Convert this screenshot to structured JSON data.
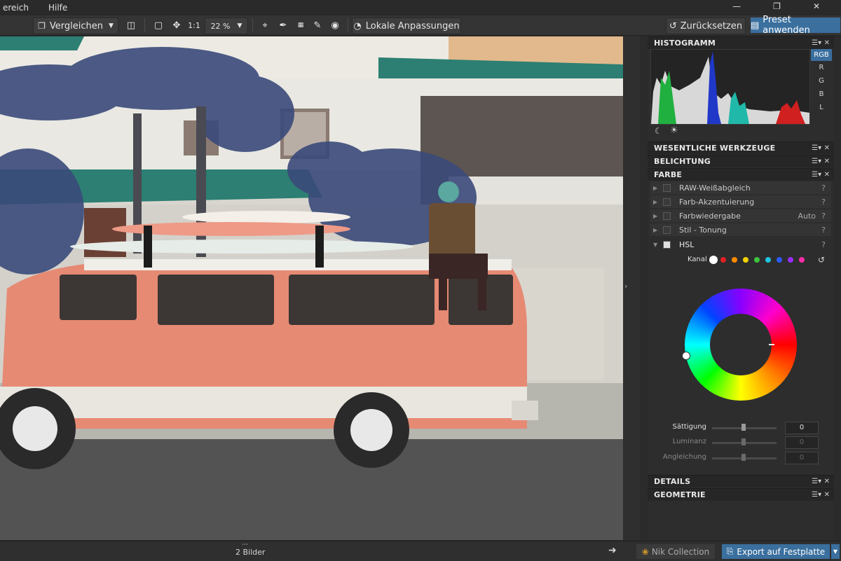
{
  "menu": {
    "items": [
      "ereich",
      "Hilfe"
    ]
  },
  "toolbar": {
    "compare_label": "Vergleichen",
    "ratio_label": "1:1",
    "zoom_value": "22 %",
    "local_adjust_label": "Lokale Anpassungen",
    "reset_label": "Zurücksetzen",
    "preset_label": "Preset anwenden"
  },
  "histogram": {
    "title": "HISTOGRAMM",
    "channels": [
      "RGB",
      "R",
      "G",
      "B",
      "L"
    ]
  },
  "sections": {
    "essentials": "WESENTLICHE WERKZEUGE",
    "exposure": "BELICHTUNG",
    "color": "FARBE",
    "details": "DETAILS",
    "geometry": "GEOMETRIE"
  },
  "color_tools": [
    {
      "label": "RAW-Weißabgleich",
      "extra": ""
    },
    {
      "label": "Farb-Akzentuierung",
      "extra": ""
    },
    {
      "label": "Farbwiedergabe",
      "extra": "Auto"
    },
    {
      "label": "Stil - Tonung",
      "extra": ""
    },
    {
      "label": "HSL",
      "extra": ""
    }
  ],
  "hsl": {
    "channel_label": "Kanal",
    "channel_colors": [
      "#ffffff",
      "#e02020",
      "#ff8a00",
      "#f2d200",
      "#3cc43c",
      "#1fc4e0",
      "#2a5bff",
      "#9a2cff",
      "#ff2ca8"
    ],
    "sliders": [
      {
        "label": "Sättigung",
        "value": "0"
      },
      {
        "label": "Luminanz",
        "value": "0"
      },
      {
        "label": "Angleichung",
        "value": "0"
      }
    ]
  },
  "status": {
    "images_count": "2 Bilder",
    "nik_label": "Nik Collection",
    "export_label": "Export auf Festplatte"
  },
  "colors": {
    "accent": "#3a6f9e",
    "van": "#e68a74",
    "panel_bg": "#2d2d2d"
  }
}
